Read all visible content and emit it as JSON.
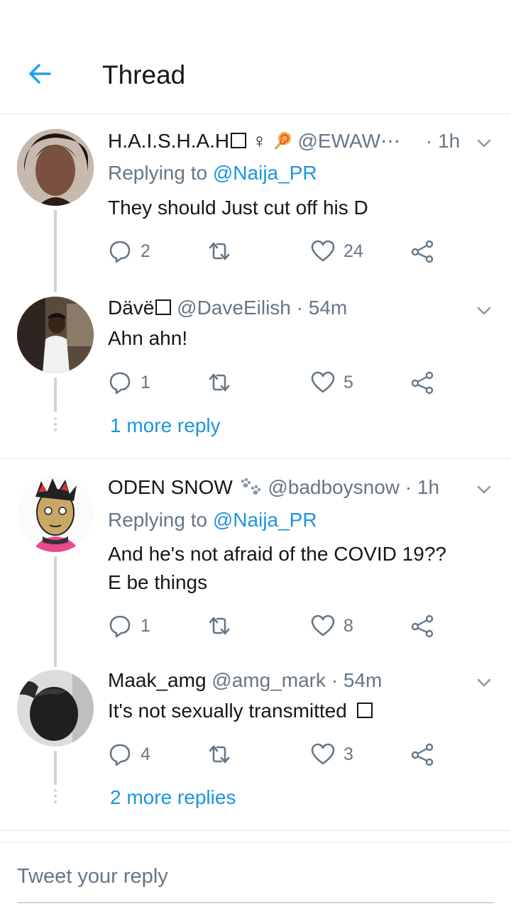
{
  "header": {
    "title": "Thread"
  },
  "tweets": [
    {
      "name": "H.A.I.S.H.A.H",
      "name_suffix": "♀",
      "handle": "@EWAW⋯",
      "time": "· 1h",
      "reply_prefix": "Replying to",
      "reply_handle": "@Naija_PR",
      "text": "They should Just cut off his D",
      "replies": "2",
      "likes": "24"
    },
    {
      "name": "Dävë",
      "handle": "@DaveEilish",
      "time": "· 54m",
      "text": "Ahn ahn!",
      "replies": "1",
      "likes": "5",
      "more": "1 more reply"
    },
    {
      "name": "ODEN SNOW",
      "handle": "@badboysnow",
      "time": "· 1h",
      "reply_prefix": "Replying to",
      "reply_handle": "@Naija_PR",
      "text_line1": "And he's not afraid of the COVID 19??",
      "text_line2": "E be things",
      "replies": "1",
      "likes": "8"
    },
    {
      "name": "Maak_amg",
      "handle": "@amg_mark",
      "time": "· 54m",
      "text": "It's not sexually transmitted",
      "replies": "4",
      "likes": "3",
      "more": "2 more replies"
    }
  ],
  "composer": {
    "placeholder": "Tweet your reply"
  },
  "colors": {
    "accent": "#1b95e0",
    "muted": "#657786",
    "line": "#ccd6dd"
  }
}
